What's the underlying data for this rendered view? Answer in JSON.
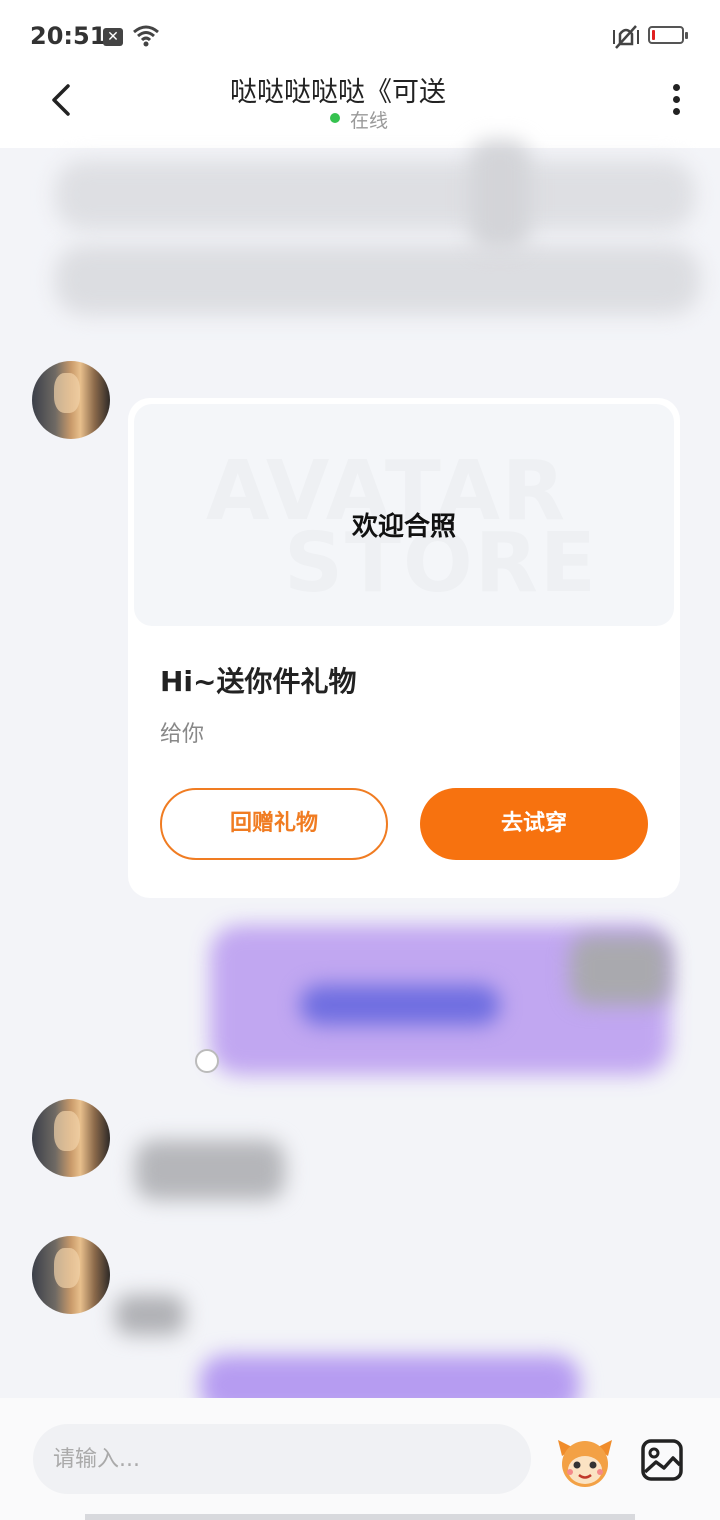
{
  "status_bar": {
    "time": "20:51",
    "battery_level": 0.1,
    "battery_color": "#e02020"
  },
  "header": {
    "title": "哒哒哒哒哒《可送",
    "status": "在线",
    "status_color": "#35c24f"
  },
  "gift_card": {
    "banner_text": "欢迎合照",
    "watermark_line1": "AVATAR",
    "watermark_line2": "STORE",
    "title": "Hi~送你件礼物",
    "message": "给你",
    "return_gift_label": "回赠礼物",
    "try_on_label": "去试穿",
    "accent_color": "#f7720f"
  },
  "input": {
    "placeholder": "请输入..."
  },
  "icons": [
    "back-icon",
    "more-icon",
    "wifi-icon",
    "vibrate-icon",
    "battery-icon",
    "mascot-icon",
    "image-icon"
  ]
}
